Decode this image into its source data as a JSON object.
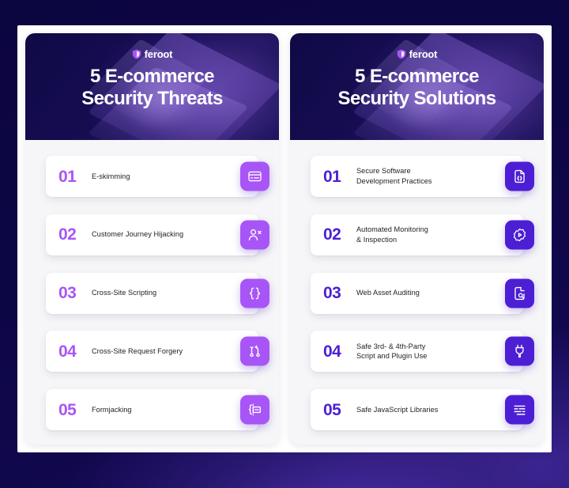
{
  "brand": {
    "name": "feroot",
    "logo_icon": "shield-icon",
    "accent_light": "#a855f7",
    "accent_deep": "#4c1fd4",
    "header_navy": "#140a52",
    "page_bg": "#0b0540"
  },
  "cards": [
    {
      "id": "threats",
      "logo_text": "feroot",
      "title_line1": "5 E-commerce",
      "title_line2": "Security Threats",
      "accent": "#a855f7",
      "items": [
        {
          "num": "01",
          "label": "E-skimming",
          "icon": "credit-card-icon"
        },
        {
          "num": "02",
          "label": "Customer Journey Hijacking",
          "icon": "user-x-icon"
        },
        {
          "num": "03",
          "label": "Cross-Site Scripting",
          "icon": "curly-braces-icon"
        },
        {
          "num": "04",
          "label": "Cross-Site Request Forgery",
          "icon": "git-branch-icon"
        },
        {
          "num": "05",
          "label": "Formjacking",
          "icon": "form-input-icon"
        }
      ]
    },
    {
      "id": "solutions",
      "logo_text": "feroot",
      "title_line1": "5 E-commerce",
      "title_line2": "Security Solutions",
      "accent": "#4c1fd4",
      "items": [
        {
          "num": "01",
          "label": "Secure Software\nDevelopment Practices",
          "icon": "file-code-icon"
        },
        {
          "num": "02",
          "label": "Automated Monitoring\n& Inspection",
          "icon": "gear-play-icon"
        },
        {
          "num": "03",
          "label": "Web Asset Auditing",
          "icon": "file-search-icon"
        },
        {
          "num": "04",
          "label": "Safe 3rd- & 4th-Party\nScript and Plugin Use",
          "icon": "plug-icon"
        },
        {
          "num": "05",
          "label": "Safe JavaScript Libraries",
          "icon": "code-lines-icon"
        }
      ]
    }
  ]
}
